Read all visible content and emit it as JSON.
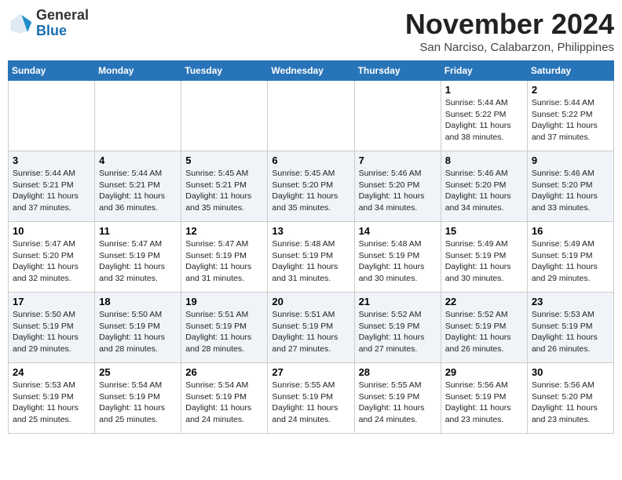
{
  "header": {
    "logo": {
      "line1": "General",
      "line2": "Blue"
    },
    "month": "November 2024",
    "location": "San Narciso, Calabarzon, Philippines"
  },
  "weekdays": [
    "Sunday",
    "Monday",
    "Tuesday",
    "Wednesday",
    "Thursday",
    "Friday",
    "Saturday"
  ],
  "weeks": [
    [
      {
        "day": "",
        "info": ""
      },
      {
        "day": "",
        "info": ""
      },
      {
        "day": "",
        "info": ""
      },
      {
        "day": "",
        "info": ""
      },
      {
        "day": "",
        "info": ""
      },
      {
        "day": "1",
        "info": "Sunrise: 5:44 AM\nSunset: 5:22 PM\nDaylight: 11 hours\nand 38 minutes."
      },
      {
        "day": "2",
        "info": "Sunrise: 5:44 AM\nSunset: 5:22 PM\nDaylight: 11 hours\nand 37 minutes."
      }
    ],
    [
      {
        "day": "3",
        "info": "Sunrise: 5:44 AM\nSunset: 5:21 PM\nDaylight: 11 hours\nand 37 minutes."
      },
      {
        "day": "4",
        "info": "Sunrise: 5:44 AM\nSunset: 5:21 PM\nDaylight: 11 hours\nand 36 minutes."
      },
      {
        "day": "5",
        "info": "Sunrise: 5:45 AM\nSunset: 5:21 PM\nDaylight: 11 hours\nand 35 minutes."
      },
      {
        "day": "6",
        "info": "Sunrise: 5:45 AM\nSunset: 5:20 PM\nDaylight: 11 hours\nand 35 minutes."
      },
      {
        "day": "7",
        "info": "Sunrise: 5:46 AM\nSunset: 5:20 PM\nDaylight: 11 hours\nand 34 minutes."
      },
      {
        "day": "8",
        "info": "Sunrise: 5:46 AM\nSunset: 5:20 PM\nDaylight: 11 hours\nand 34 minutes."
      },
      {
        "day": "9",
        "info": "Sunrise: 5:46 AM\nSunset: 5:20 PM\nDaylight: 11 hours\nand 33 minutes."
      }
    ],
    [
      {
        "day": "10",
        "info": "Sunrise: 5:47 AM\nSunset: 5:20 PM\nDaylight: 11 hours\nand 32 minutes."
      },
      {
        "day": "11",
        "info": "Sunrise: 5:47 AM\nSunset: 5:19 PM\nDaylight: 11 hours\nand 32 minutes."
      },
      {
        "day": "12",
        "info": "Sunrise: 5:47 AM\nSunset: 5:19 PM\nDaylight: 11 hours\nand 31 minutes."
      },
      {
        "day": "13",
        "info": "Sunrise: 5:48 AM\nSunset: 5:19 PM\nDaylight: 11 hours\nand 31 minutes."
      },
      {
        "day": "14",
        "info": "Sunrise: 5:48 AM\nSunset: 5:19 PM\nDaylight: 11 hours\nand 30 minutes."
      },
      {
        "day": "15",
        "info": "Sunrise: 5:49 AM\nSunset: 5:19 PM\nDaylight: 11 hours\nand 30 minutes."
      },
      {
        "day": "16",
        "info": "Sunrise: 5:49 AM\nSunset: 5:19 PM\nDaylight: 11 hours\nand 29 minutes."
      }
    ],
    [
      {
        "day": "17",
        "info": "Sunrise: 5:50 AM\nSunset: 5:19 PM\nDaylight: 11 hours\nand 29 minutes."
      },
      {
        "day": "18",
        "info": "Sunrise: 5:50 AM\nSunset: 5:19 PM\nDaylight: 11 hours\nand 28 minutes."
      },
      {
        "day": "19",
        "info": "Sunrise: 5:51 AM\nSunset: 5:19 PM\nDaylight: 11 hours\nand 28 minutes."
      },
      {
        "day": "20",
        "info": "Sunrise: 5:51 AM\nSunset: 5:19 PM\nDaylight: 11 hours\nand 27 minutes."
      },
      {
        "day": "21",
        "info": "Sunrise: 5:52 AM\nSunset: 5:19 PM\nDaylight: 11 hours\nand 27 minutes."
      },
      {
        "day": "22",
        "info": "Sunrise: 5:52 AM\nSunset: 5:19 PM\nDaylight: 11 hours\nand 26 minutes."
      },
      {
        "day": "23",
        "info": "Sunrise: 5:53 AM\nSunset: 5:19 PM\nDaylight: 11 hours\nand 26 minutes."
      }
    ],
    [
      {
        "day": "24",
        "info": "Sunrise: 5:53 AM\nSunset: 5:19 PM\nDaylight: 11 hours\nand 25 minutes."
      },
      {
        "day": "25",
        "info": "Sunrise: 5:54 AM\nSunset: 5:19 PM\nDaylight: 11 hours\nand 25 minutes."
      },
      {
        "day": "26",
        "info": "Sunrise: 5:54 AM\nSunset: 5:19 PM\nDaylight: 11 hours\nand 24 minutes."
      },
      {
        "day": "27",
        "info": "Sunrise: 5:55 AM\nSunset: 5:19 PM\nDaylight: 11 hours\nand 24 minutes."
      },
      {
        "day": "28",
        "info": "Sunrise: 5:55 AM\nSunset: 5:19 PM\nDaylight: 11 hours\nand 24 minutes."
      },
      {
        "day": "29",
        "info": "Sunrise: 5:56 AM\nSunset: 5:19 PM\nDaylight: 11 hours\nand 23 minutes."
      },
      {
        "day": "30",
        "info": "Sunrise: 5:56 AM\nSunset: 5:20 PM\nDaylight: 11 hours\nand 23 minutes."
      }
    ]
  ]
}
